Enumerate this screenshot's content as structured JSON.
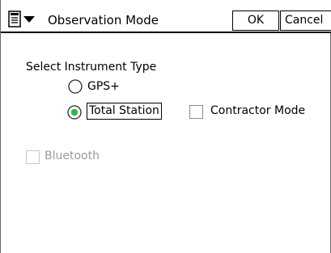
{
  "window": {
    "title": "Observation Mode",
    "ok_label": "OK",
    "cancel_label": "Cancel"
  },
  "instrument": {
    "section_label": "Select Instrument Type",
    "options": [
      {
        "label": "GPS+",
        "selected": false
      },
      {
        "label": "Total Station",
        "selected": true
      }
    ]
  },
  "contractor_mode": {
    "label": "Contractor Mode",
    "checked": false
  },
  "bluetooth": {
    "label": "Bluetooth",
    "checked": false,
    "enabled": false
  },
  "icons": {
    "menu": "menu-list-icon",
    "dropdown": "triangle-down-icon",
    "radio_selected_color": "#2fb84a"
  }
}
